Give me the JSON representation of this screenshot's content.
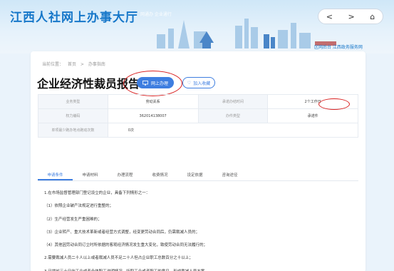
{
  "header": {
    "brand": "江西人社网上办事大厅",
    "tagline": "网通办 企业通行",
    "sub_link": "区网后台 江西政务服务网",
    "nav": {
      "back": "<",
      "forward": ">",
      "home": "⌂"
    }
  },
  "breadcrumb": [
    "当前位置：",
    "首页",
    ">",
    "办事指南"
  ],
  "page_title": "企业经济性裁员报告",
  "actions": {
    "online": "网上办理",
    "favorite": "加入收藏"
  },
  "info": {
    "rows": [
      [
        "业务类型",
        "劳动关系",
        "承诺办结时间",
        "2个工作日"
      ],
      [
        "权力编码",
        "362014138007",
        "办件类型",
        "承诺件"
      ],
      [
        "单项最少跑办地点跑动次数",
        "0次",
        "",
        ""
      ]
    ]
  },
  "tabs": [
    "申请条件",
    "申请材料",
    "办理流程",
    "收费情况",
    "设定依据",
    "咨询途径"
  ],
  "conditions": [
    "1.在市场监督管理部门登记设立的企业，具备下列情形之一：",
    "（1）依照企业破产法规定进行重整的；",
    "（2）生产经营发生严重困难的；",
    "（3）企业转产、重大技术革新或者经营方式调整，经变更劳动合同后，仍需裁减人员的；",
    "（4）其他因劳动合同订立时所依据的客观经济情况发生重大变化，致使劳动合同无法履行的；",
    "2.需要裁减人员二十人以上或者裁减人员不足二十人但占企业职工总数百分之十以上；",
    "3.已提前三十日向工会或者全体职工说明情况，听取工会或者职工的意见，形成裁减人员方案。"
  ],
  "colors": {
    "accent": "#3e7ee0",
    "brand": "#1677c9",
    "annotation": "#d92020"
  }
}
